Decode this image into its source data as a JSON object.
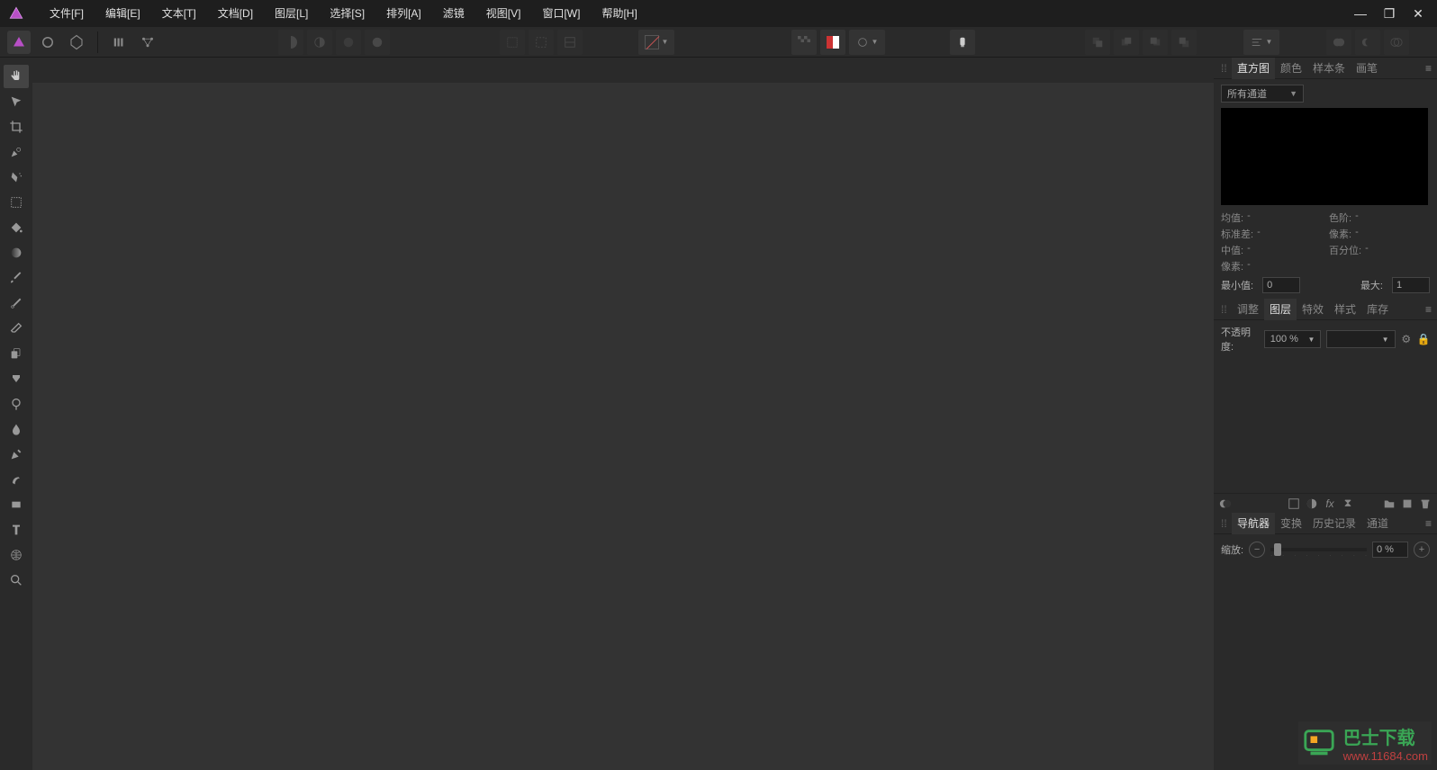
{
  "menu": {
    "file": "文件[F]",
    "edit": "编辑[E]",
    "text": "文本[T]",
    "document": "文档[D]",
    "layer": "图层[L]",
    "select": "选择[S]",
    "arrange": "排列[A]",
    "filters": "滤镜",
    "view": "视图[V]",
    "window": "窗口[W]",
    "help": "帮助[H]"
  },
  "panels": {
    "histogram": {
      "tabs": {
        "histogram": "直方图",
        "colour": "颜色",
        "swatches": "样本条",
        "brushes": "画笔"
      },
      "channel_dropdown": "所有通道",
      "stats": {
        "mean_label": "均值:",
        "mean_val": "-",
        "stddev_label": "标准差:",
        "stddev_val": "-",
        "median_label": "中值:",
        "median_val": "-",
        "pixels_label": "像素:",
        "pixels_val": "-",
        "colorlevel_label": "色阶:",
        "colorlevel_val": "-",
        "pixel2_label": "像素:",
        "pixel2_val": "-",
        "percentile_label": "百分位:",
        "percentile_val": "-"
      },
      "min_label": "最小值:",
      "min_val": "0",
      "max_label": "最大:",
      "max_val": "1"
    },
    "layers": {
      "tabs": {
        "adjust": "调整",
        "layers": "图层",
        "fx": "特效",
        "styles": "样式",
        "stock": "库存"
      },
      "opacity_label": "不透明度:",
      "opacity_value": "100 %"
    },
    "navigator": {
      "tabs": {
        "nav": "导航器",
        "transform": "变换",
        "history": "历史记录",
        "channels": "通道"
      },
      "zoom_label": "缩放:",
      "zoom_value": "0 %"
    }
  },
  "watermark": {
    "text": "巴士下载",
    "url": "www.11684.com"
  }
}
